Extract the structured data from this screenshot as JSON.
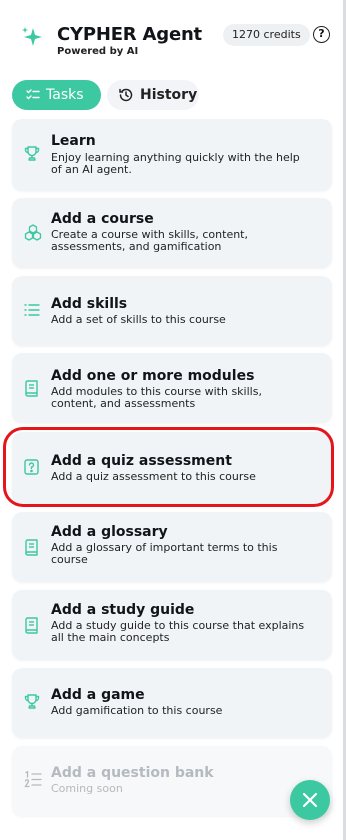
{
  "header": {
    "title": "CYPHER Agent",
    "subtitle": "Powered by AI",
    "credits": "1270 credits",
    "help_icon": "question-circle-icon"
  },
  "tabs": [
    {
      "label": "Tasks",
      "active": true,
      "icon": "checklist-icon"
    },
    {
      "label": "History",
      "active": false,
      "icon": "history-icon"
    }
  ],
  "tasks": [
    {
      "title": "Learn",
      "description": "Enjoy learning anything quickly with the help of an AI agent.",
      "icon": "trophy-icon"
    },
    {
      "title": "Add a course",
      "description": "Create a course with skills, content, assessments, and gamification",
      "icon": "blocks-icon"
    },
    {
      "title": "Add skills",
      "description": "Add a set of skills to this course",
      "icon": "list-icon"
    },
    {
      "title": "Add one or more modules",
      "description": "Add modules to this course with skills, content, and assessments",
      "icon": "book-icon"
    },
    {
      "title": "Add a quiz assessment",
      "description": "Add a quiz assessment to this course",
      "icon": "quiz-icon",
      "highlighted": true
    },
    {
      "title": "Add a glossary",
      "description": "Add a glossary of important terms to this course",
      "icon": "book-icon"
    },
    {
      "title": "Add a study guide",
      "description": "Add a study guide to this course that explains all the main concepts",
      "icon": "book-icon"
    },
    {
      "title": "Add a game",
      "description": "Add gamification to this course",
      "icon": "trophy-icon"
    },
    {
      "title": "Add a question bank",
      "description": "Coming soon",
      "icon": "numbered-list-icon",
      "disabled": true
    }
  ],
  "fab": {
    "icon": "close-icon"
  },
  "colors": {
    "accent": "#3cc8a1",
    "highlight": "#e4151b",
    "card": "#f1f4f7"
  }
}
